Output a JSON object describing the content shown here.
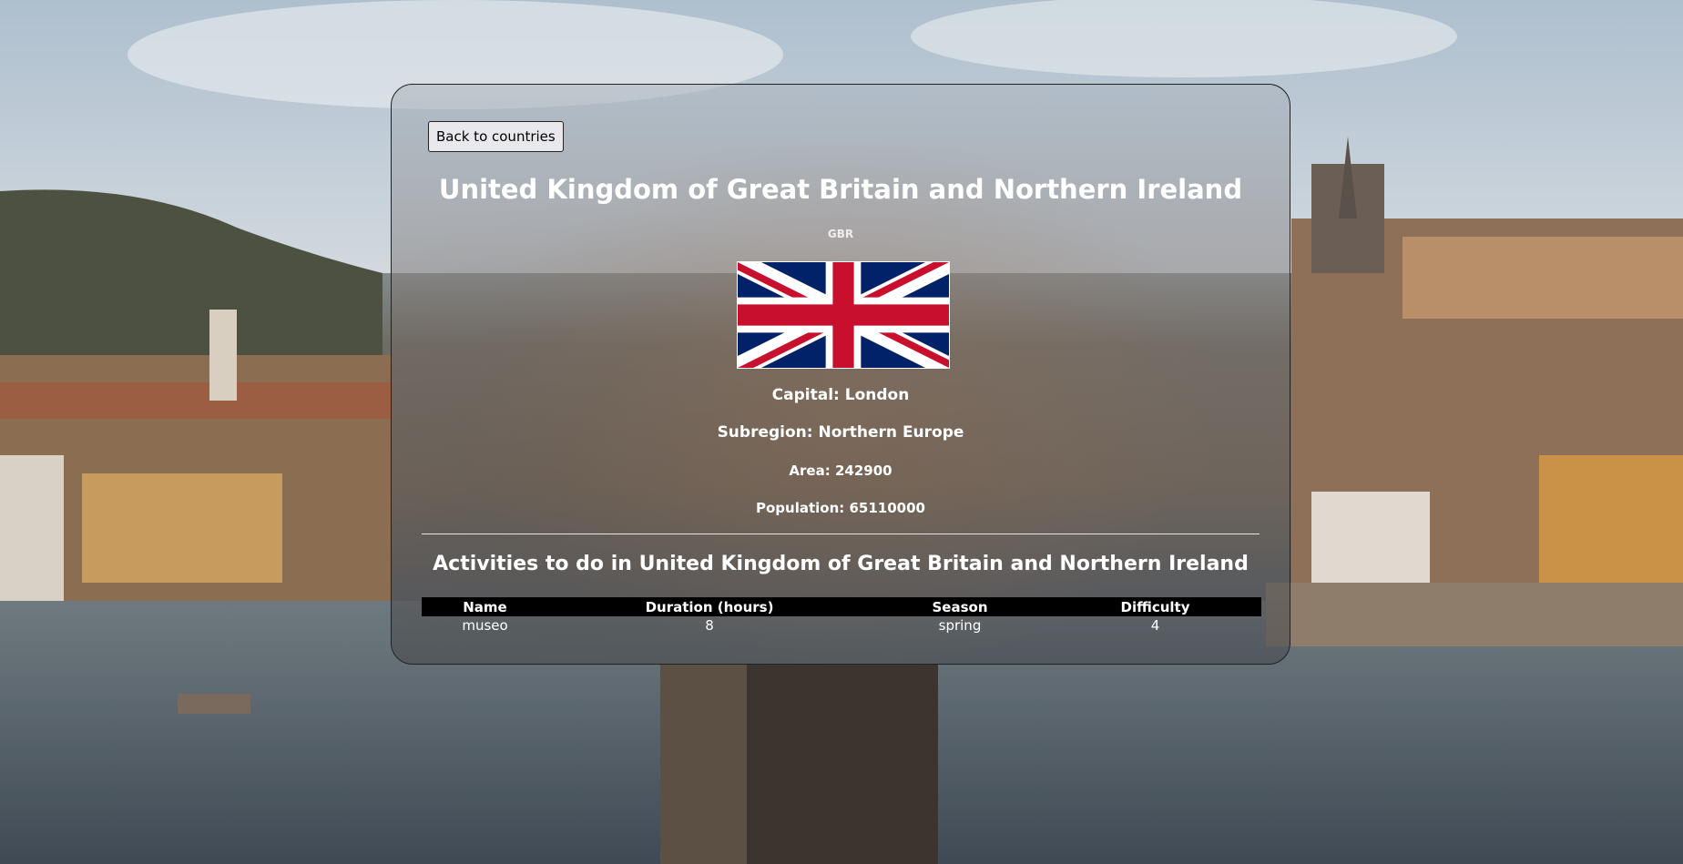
{
  "navigation": {
    "back_label": "Back to countries"
  },
  "country": {
    "name": "United Kingdom of Great Britain and Northern Ireland",
    "code": "GBR",
    "flag_icon": "uk-flag-icon",
    "capital_text": "Capital: London",
    "subregion_text": "Subregion: Northern Europe",
    "area_text": "Area: 242900",
    "population_text": "Population: 65110000"
  },
  "activities": {
    "heading": "Activities to do in United Kingdom of Great Britain and Northern Ireland",
    "columns": [
      "Name",
      "Duration (hours)",
      "Season",
      "Difficulty"
    ],
    "rows": [
      [
        "museo",
        "8",
        "spring",
        "4"
      ]
    ]
  },
  "colors": {
    "flag_blue": "#012169",
    "flag_red": "#C8102E",
    "table_header_bg": "#000000"
  }
}
